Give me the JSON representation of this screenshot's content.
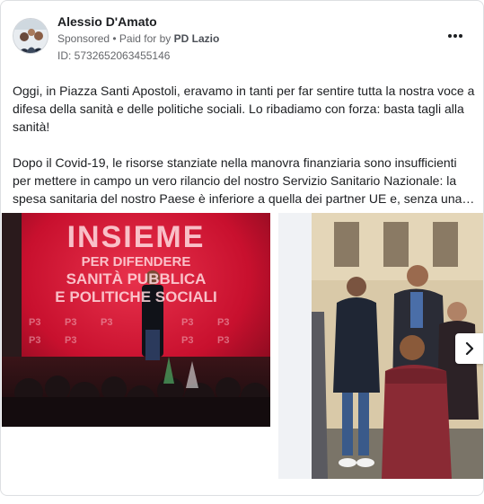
{
  "ad": {
    "advertiser_name": "Alessio D'Amato",
    "sponsored_label": "Sponsored",
    "separator": " • ",
    "paid_for_prefix": "Paid for by ",
    "paid_for_by": "PD Lazio",
    "ad_id": "ID: 5732652063455146",
    "more_icon": "more-horizontal-icon"
  },
  "post": {
    "paragraph_1": "Oggi, in Piazza Santi Apostoli, eravamo in tanti per far sentire tutta la nostra voce a difesa della sanità e delle politiche sociali. Lo ribadiamo con forza: basta tagli alla sanità!",
    "paragraph_2": "Dopo il Covid-19, le risorse stanziate nella manovra finanziaria sono insufficienti per mettere in campo un vero rilancio del nostro Servizio Sanitario Nazionale: la spesa sanitaria del nostro Paese è inferiore a quella dei partner UE e, senza una manovra adeguata, il sistema rischia di non reggere."
  },
  "carousel": {
    "image_1_banner_line1": "INSIEME",
    "image_1_banner_line2": "PER DIFENDERE",
    "image_1_banner_line3": "SANITÀ PUBBLICA",
    "image_1_banner_line4": "E POLITICHE SOCIALI",
    "next_icon": "chevron-right-icon"
  },
  "colors": {
    "stage_red": "#c8102e",
    "text_primary": "#1c1e21",
    "text_secondary": "#65676b"
  }
}
